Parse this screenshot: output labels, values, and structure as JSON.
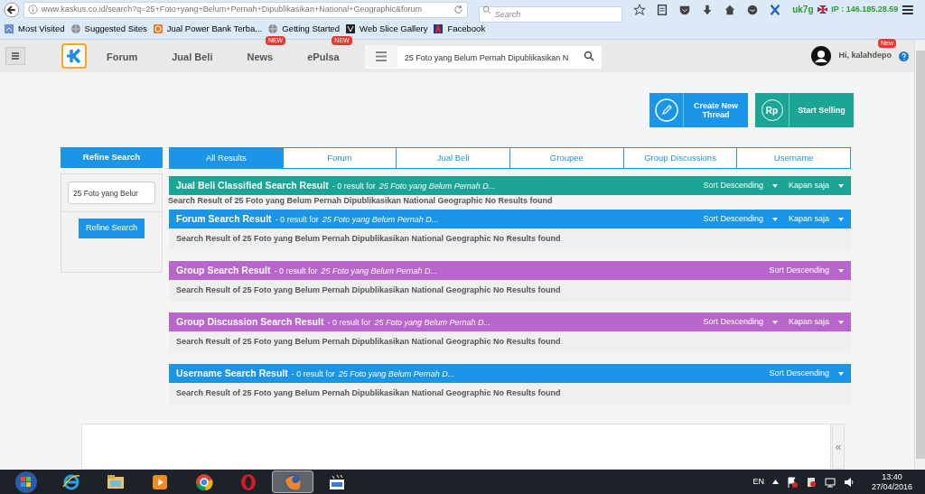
{
  "browser": {
    "url": "www.kaskus.co.id/search?q=25+Foto+yang+Belum+Pernah+Dipublikasikan+National+Geographic&forum",
    "search_placeholder": "Search",
    "user_label": "uk7g",
    "ip": "IP : 146.185.28.59"
  },
  "bookmarks": [
    {
      "label": "Most Visited",
      "kind": "page"
    },
    {
      "label": "Suggested Sites",
      "kind": "globe"
    },
    {
      "label": "Jual Power Bank Terba...",
      "kind": "orange"
    },
    {
      "label": "Getting Started",
      "kind": "globe"
    },
    {
      "label": "Web Slice Gallery",
      "kind": "dark"
    },
    {
      "label": "Facebook",
      "kind": "red"
    }
  ],
  "nav": {
    "items": [
      {
        "label": "Forum"
      },
      {
        "label": "Jual Beli"
      },
      {
        "label": "News",
        "badge": "NEW"
      },
      {
        "label": "ePulsa",
        "badge": "NEW"
      }
    ],
    "search_value": "25 Foto yang Belum Pernah Dipublikasikan N",
    "user": "Hi, kalahdepo",
    "user_badge": "New"
  },
  "actions": [
    {
      "label": "Create New Thread",
      "kind": "pencil"
    },
    {
      "label": "Start Selling",
      "kind": "rp",
      "icon_text": "Rp"
    }
  ],
  "refine": {
    "title": "Refine Search",
    "value": "25 Foto yang Belur",
    "button": "Refine Search"
  },
  "tabs": [
    {
      "label": "All Results",
      "selected": true
    },
    {
      "label": "Forum",
      "selected": false
    },
    {
      "label": "Jual Beli",
      "selected": false
    },
    {
      "label": "Groupee",
      "selected": false
    },
    {
      "label": "Group Discussions",
      "selected": false
    },
    {
      "label": "Username",
      "selected": false
    }
  ],
  "sections": [
    {
      "title": "Jual Beli Classified Search Result",
      "summary": "- 0 result for",
      "query": "25 Foto yang Belum Pernah D...",
      "color": "#1ba595",
      "controls": [
        "Sort Descending",
        "Kapan saja"
      ],
      "boxed": false,
      "message": "Search Result of 25 Foto yang Belum Pernah Dipublikasikan National Geographic No Results found"
    },
    {
      "title": "Forum Search Result",
      "summary": "- 0 result for",
      "query": "25 Foto yang Belum Pernah D...",
      "color": "#1a95e8",
      "controls": [
        "Sort Descending",
        "Kapan saja"
      ],
      "boxed": true,
      "message": "Search Result of 25 Foto yang Belum Pernah Dipublikasikan National Geographic No Results found"
    },
    {
      "title": "Group Search Result",
      "summary": "- 0 result for",
      "query": "25 Foto yang Belum Pernah D...",
      "color": "#b866cc",
      "controls": [
        "Sort Descending"
      ],
      "boxed": true,
      "message": "Search Result of 25 Foto yang Belum Pernah Dipublikasikan National Geographic No Results found"
    },
    {
      "title": "Group Discussion Search Result",
      "summary": "- 0 result for",
      "query": "25 Foto yang Belum Pernah D...",
      "color": "#b866cc",
      "controls": [
        "Sort Descending",
        "Kapan saja"
      ],
      "boxed": true,
      "message": "Search Result of 25 Foto yang Belum Pernah Dipublikasikan National Geographic No Results found"
    },
    {
      "title": "Username Search Result",
      "summary": "- 0 result for",
      "query": "25 Foto yang Belum Pernah D...",
      "color": "#1a95e8",
      "controls": [
        "Sort Descending"
      ],
      "boxed": true,
      "message": "Search Result of 25 Foto yang Belum Pernah Dipublikasikan National Geographic No Results found"
    }
  ],
  "collapse_glyph": "«",
  "taskbar": {
    "apps": [
      {
        "kind": "ie",
        "selected": false
      },
      {
        "kind": "folder",
        "selected": false
      },
      {
        "kind": "media",
        "selected": false
      },
      {
        "kind": "chrome",
        "selected": false
      },
      {
        "kind": "opera",
        "selected": false
      },
      {
        "kind": "firefox",
        "selected": true
      },
      {
        "kind": "clapper",
        "selected": false
      }
    ],
    "language": "EN",
    "time": "13:40",
    "date": "27/04/2016"
  }
}
